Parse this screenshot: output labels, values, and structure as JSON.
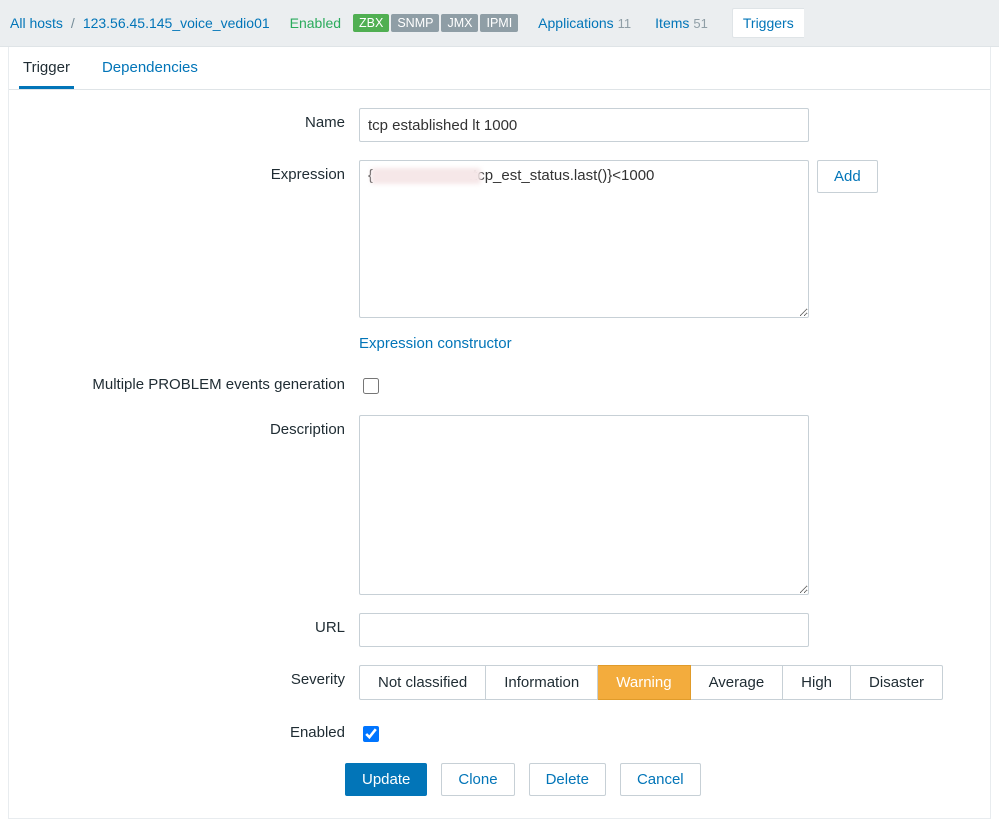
{
  "topbar": {
    "all_hosts": "All hosts",
    "host_name": "123.56.45.145_voice_vedio01",
    "enabled": "Enabled",
    "badges": {
      "zbx": "ZBX",
      "snmp": "SNMP",
      "jmx": "JMX",
      "ipmi": "IPMI"
    },
    "applications_label": "Applications",
    "applications_count": "11",
    "items_label": "Items",
    "items_count": "51",
    "triggers_label": "Triggers"
  },
  "tabs": {
    "trigger": "Trigger",
    "dependencies": "Dependencies"
  },
  "form": {
    "name_label": "Name",
    "name_value": "tcp established lt 1000",
    "expression_label": "Expression",
    "expression_value": "{                       .tcp_est_status.last()}<1000",
    "add_btn": "Add",
    "expression_constructor": "Expression constructor",
    "multiple_label": "Multiple PROBLEM events generation",
    "multiple_checked": false,
    "description_label": "Description",
    "description_value": "",
    "url_label": "URL",
    "url_value": "",
    "severity_label": "Severity",
    "severity_options": [
      "Not classified",
      "Information",
      "Warning",
      "Average",
      "High",
      "Disaster"
    ],
    "severity_selected": "Warning",
    "enabled_label": "Enabled",
    "enabled_checked": true
  },
  "actions": {
    "update": "Update",
    "clone": "Clone",
    "delete": "Delete",
    "cancel": "Cancel"
  }
}
